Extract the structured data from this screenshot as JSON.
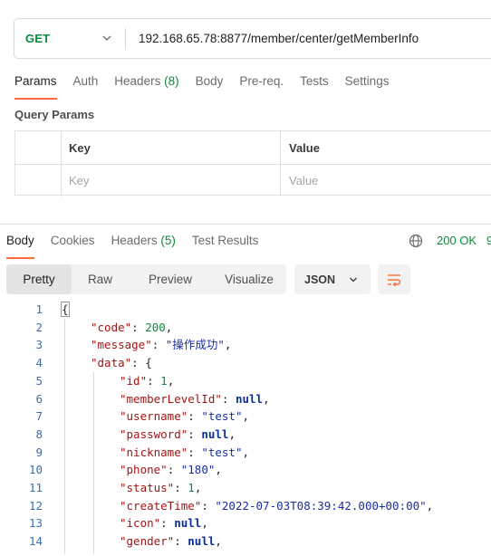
{
  "request": {
    "method": "GET",
    "url": "192.168.65.78:8877/member/center/getMemberInfo",
    "tabs": [
      {
        "label": "Params",
        "count": ""
      },
      {
        "label": "Auth",
        "count": ""
      },
      {
        "label": "Headers",
        "count": "(8)"
      },
      {
        "label": "Body",
        "count": ""
      },
      {
        "label": "Pre-req.",
        "count": ""
      },
      {
        "label": "Tests",
        "count": ""
      },
      {
        "label": "Settings",
        "count": ""
      }
    ],
    "query_params_title": "Query Params",
    "table": {
      "key_header": "Key",
      "value_header": "Value",
      "key_placeholder": "Key",
      "value_placeholder": "Value"
    }
  },
  "response": {
    "tabs": [
      {
        "label": "Body",
        "count": ""
      },
      {
        "label": "Cookies",
        "count": ""
      },
      {
        "label": "Headers",
        "count": "(5)"
      },
      {
        "label": "Test Results",
        "count": ""
      }
    ],
    "status": "200 OK",
    "status_overflow": "9",
    "views": [
      "Pretty",
      "Raw",
      "Preview",
      "Visualize"
    ],
    "format": "JSON",
    "body_lines": [
      {
        "n": "1",
        "indent": 0,
        "key": "",
        "value": "",
        "vtype": "brace",
        "text": "{"
      },
      {
        "n": "2",
        "indent": 1,
        "key": "code",
        "value": "200",
        "vtype": "num"
      },
      {
        "n": "3",
        "indent": 1,
        "key": "message",
        "value": "操作成功",
        "vtype": "str"
      },
      {
        "n": "4",
        "indent": 1,
        "key": "data",
        "value": "{",
        "vtype": "open"
      },
      {
        "n": "5",
        "indent": 2,
        "key": "id",
        "value": "1",
        "vtype": "num"
      },
      {
        "n": "6",
        "indent": 2,
        "key": "memberLevelId",
        "value": "null",
        "vtype": "kw"
      },
      {
        "n": "7",
        "indent": 2,
        "key": "username",
        "value": "test",
        "vtype": "str"
      },
      {
        "n": "8",
        "indent": 2,
        "key": "password",
        "value": "null",
        "vtype": "kw"
      },
      {
        "n": "9",
        "indent": 2,
        "key": "nickname",
        "value": "test",
        "vtype": "str"
      },
      {
        "n": "10",
        "indent": 2,
        "key": "phone",
        "value": "180",
        "vtype": "str"
      },
      {
        "n": "11",
        "indent": 2,
        "key": "status",
        "value": "1",
        "vtype": "num"
      },
      {
        "n": "12",
        "indent": 2,
        "key": "createTime",
        "value": "2022-07-03T08:39:42.000+00:00",
        "vtype": "str"
      },
      {
        "n": "13",
        "indent": 2,
        "key": "icon",
        "value": "null",
        "vtype": "kw"
      },
      {
        "n": "14",
        "indent": 2,
        "key": "gender",
        "value": "null",
        "vtype": "kw"
      }
    ]
  },
  "colors": {
    "method": "#0a8a3c",
    "accent": "#ff6c37",
    "status": "#0a8a3c",
    "json_key": "#a31515",
    "json_string": "#1a2ea3",
    "json_number": "#0a8a3c",
    "json_null": "#0b2e9e"
  },
  "icons": {
    "method_dropdown": "chevron-down-icon",
    "network": "globe-icon",
    "format_dropdown": "chevron-down-icon",
    "wrap": "wrap-lines-icon"
  }
}
